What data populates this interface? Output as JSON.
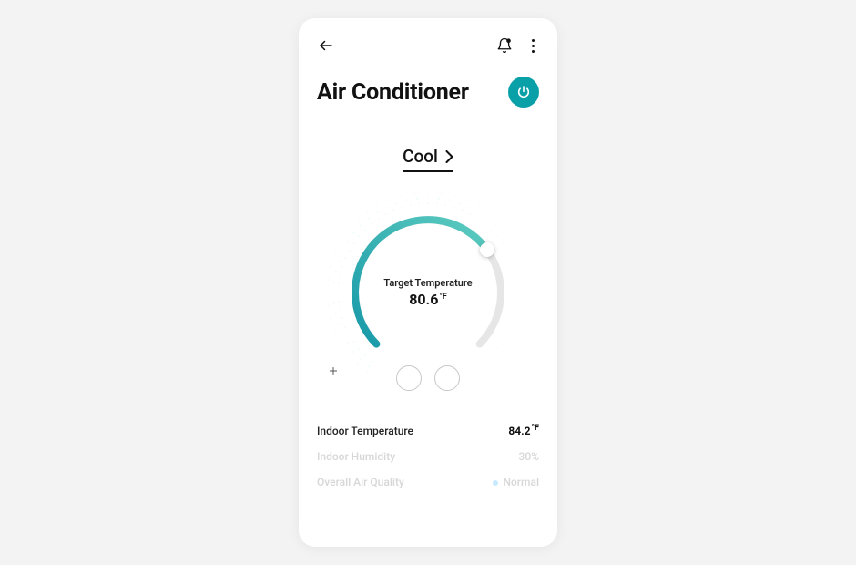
{
  "header": {
    "title": "Air Conditioner"
  },
  "mode": {
    "label": "Cool"
  },
  "dial": {
    "target_label": "Target Temperature",
    "target_value": "80.6",
    "target_unit": "°F"
  },
  "stats": {
    "indoor_temp_label": "Indoor Temperature",
    "indoor_temp_value": "84.2",
    "indoor_temp_unit": "°F",
    "indoor_humidity_label": "Indoor Humidity",
    "indoor_humidity_value": "30%",
    "air_quality_label": "Overall Air Quality",
    "air_quality_value": "Normal"
  },
  "colors": {
    "accent": "#0aa0a8"
  }
}
